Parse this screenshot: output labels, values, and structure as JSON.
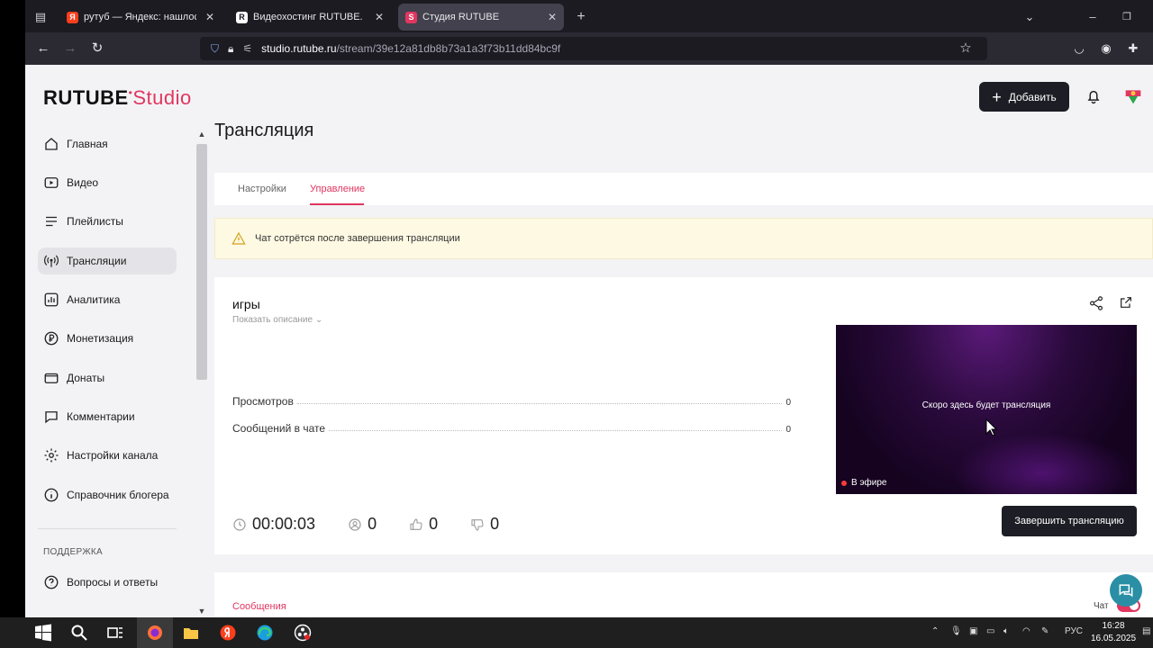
{
  "browser": {
    "tabs": [
      {
        "title": "рутуб — Яндекс: нашлось 3 млн",
        "favicon": "Я",
        "color": "#fc3f1d"
      },
      {
        "title": "Видеохостинг RUTUBE. Смотри",
        "favicon": "R",
        "color": "#141423"
      },
      {
        "title": "Студия RUTUBE",
        "favicon": "S",
        "color": "#e03660"
      }
    ],
    "url_host": "studio.rutube.ru",
    "url_path": "/stream/39e12a81db8b73a1a3f73b11dd84bc9f"
  },
  "header": {
    "logo_main": "RUTUBE",
    "logo_studio": "Studio",
    "add_label": "Добавить"
  },
  "sidebar": {
    "items": [
      {
        "label": "Главная",
        "icon": "home-icon"
      },
      {
        "label": "Видео",
        "icon": "video-icon"
      },
      {
        "label": "Плейлисты",
        "icon": "playlist-icon"
      },
      {
        "label": "Трансляции",
        "icon": "broadcast-icon"
      },
      {
        "label": "Аналитика",
        "icon": "analytics-icon"
      },
      {
        "label": "Монетизация",
        "icon": "ruble-icon"
      },
      {
        "label": "Донаты",
        "icon": "wallet-icon"
      },
      {
        "label": "Комментарии",
        "icon": "comment-icon"
      },
      {
        "label": "Настройки канала",
        "icon": "gear-icon"
      },
      {
        "label": "Справочник блогера",
        "icon": "info-icon"
      }
    ],
    "section_support": "ПОДДЕРЖКА",
    "support_items": [
      {
        "label": "Вопросы и ответы",
        "icon": "help-icon"
      }
    ]
  },
  "main": {
    "page_title": "Трансляция",
    "tabs": [
      {
        "label": "Настройки"
      },
      {
        "label": "Управление"
      }
    ],
    "warning": "Чат сотрётся после завершения трансляции",
    "stream": {
      "title": "игры",
      "show_description": "Показать описание",
      "stats": [
        {
          "label": "Просмотров",
          "value": "0"
        },
        {
          "label": "Сообщений в чате",
          "value": "0"
        }
      ],
      "preview_text": "Скоро здесь будет трансляция",
      "on_air": "В эфире",
      "duration": "00:00:03",
      "viewers": "0",
      "likes": "0",
      "dislikes": "0",
      "end_button": "Завершить трансляцию"
    },
    "messages_tab": "Сообщения",
    "chat_label": "Чат"
  },
  "taskbar": {
    "lang": "РУС",
    "time": "16:28",
    "date": "16.05.2025"
  }
}
